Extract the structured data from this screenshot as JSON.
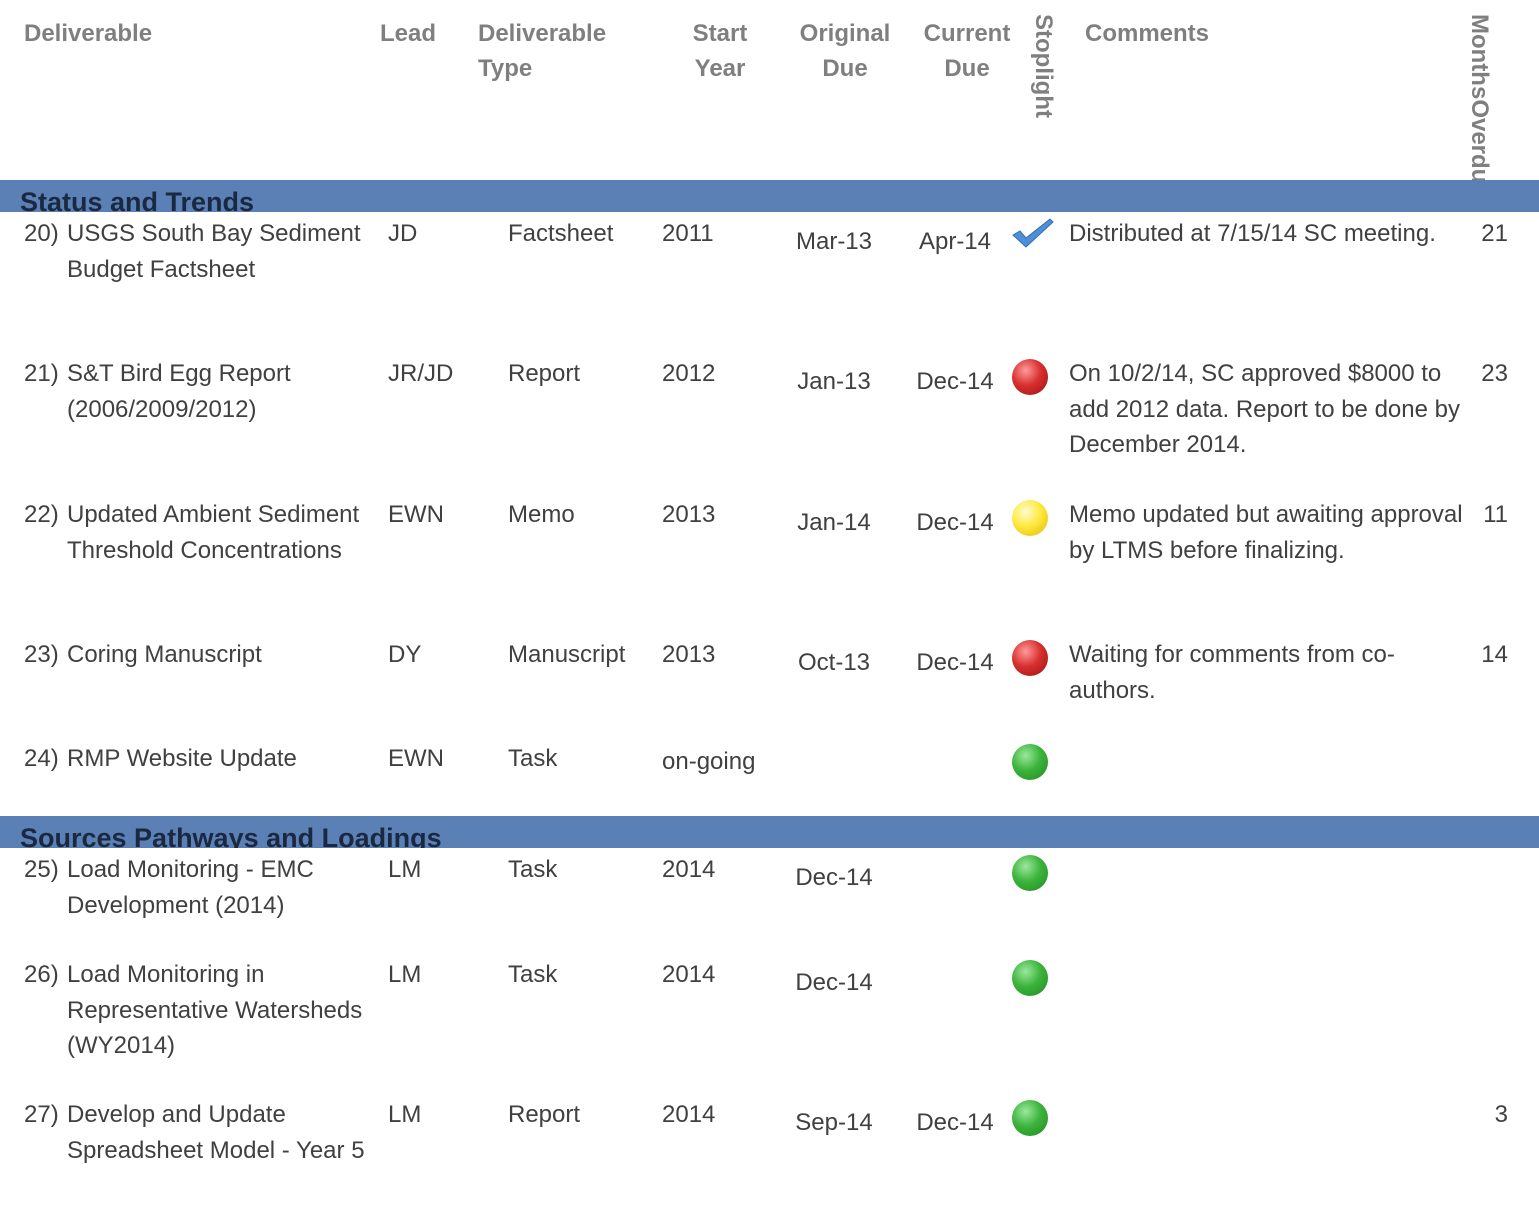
{
  "headers": {
    "deliverable": "Deliverable",
    "lead": "Lead",
    "type_line1": "Deliverable",
    "type_line2": "Type",
    "start_line1": "Start",
    "start_line2": "Year",
    "orig_line1": "Original",
    "orig_line2": "Due",
    "curr_line1": "Current",
    "curr_line2": "Due",
    "stoplight": "Stoplight",
    "comments": "Comments",
    "months": "Months",
    "overdue": "Overdue"
  },
  "sections": [
    {
      "title": "Status and Trends",
      "rows": [
        {
          "num": "20)",
          "name": "USGS South Bay Sediment Budget Factsheet",
          "lead": "JD",
          "type": "Factsheet",
          "start": "2011",
          "orig": "Mar-13",
          "curr": "Apr-14",
          "light": "check",
          "comment": "Distributed at 7/15/14 SC meeting.",
          "overdue": "21"
        },
        {
          "num": "21)",
          "name": "S&T Bird Egg Report (2006/2009/2012)",
          "lead": "JR/JD",
          "type": "Report",
          "start": "2012",
          "orig": "Jan-13",
          "curr": "Dec-14",
          "light": "red",
          "comment": "On 10/2/14, SC approved $8000 to add 2012 data. Report to be done by December 2014.",
          "overdue": "23"
        },
        {
          "num": "22)",
          "name": "Updated Ambient Sediment Threshold Concentrations",
          "lead": "EWN",
          "type": "Memo",
          "start": "2013",
          "orig": "Jan-14",
          "curr": "Dec-14",
          "light": "yellow",
          "comment": "Memo updated but awaiting approval by LTMS before finalizing.",
          "overdue": "11"
        },
        {
          "num": "23)",
          "name": "Coring Manuscript",
          "lead": "DY",
          "type": "Manuscript",
          "start": "2013",
          "orig": "Oct-13",
          "curr": "Dec-14",
          "light": "red",
          "comment": "Waiting for comments from co-authors.",
          "overdue": "14"
        },
        {
          "num": "24)",
          "name": "RMP Website Update",
          "lead": "EWN",
          "type": "Task",
          "start": "on-going",
          "orig": "",
          "curr": "",
          "light": "green",
          "comment": "",
          "overdue": ""
        }
      ]
    },
    {
      "title": "Sources Pathways and Loadings",
      "rows": [
        {
          "num": "25)",
          "name": "Load Monitoring - EMC Development (2014)",
          "lead": "LM",
          "type": "Task",
          "start": "2014",
          "orig": "Dec-14",
          "curr": "",
          "light": "green",
          "comment": "",
          "overdue": ""
        },
        {
          "num": "26)",
          "name": "Load Monitoring in Representative Watersheds (WY2014)",
          "lead": "LM",
          "type": "Task",
          "start": "2014",
          "orig": "Dec-14",
          "curr": "",
          "light": "green",
          "comment": "",
          "overdue": ""
        },
        {
          "num": "27)",
          "name": "Develop and Update Spreadsheet Model - Year 5",
          "lead": "LM",
          "type": "Report",
          "start": "2014",
          "orig": "Sep-14",
          "curr": "Dec-14",
          "light": "green",
          "comment": "",
          "overdue": "3"
        }
      ]
    }
  ],
  "colors": {
    "section_bar": "#5b80b5",
    "header_text": "#7f7f7f",
    "body_text": "#404040"
  }
}
